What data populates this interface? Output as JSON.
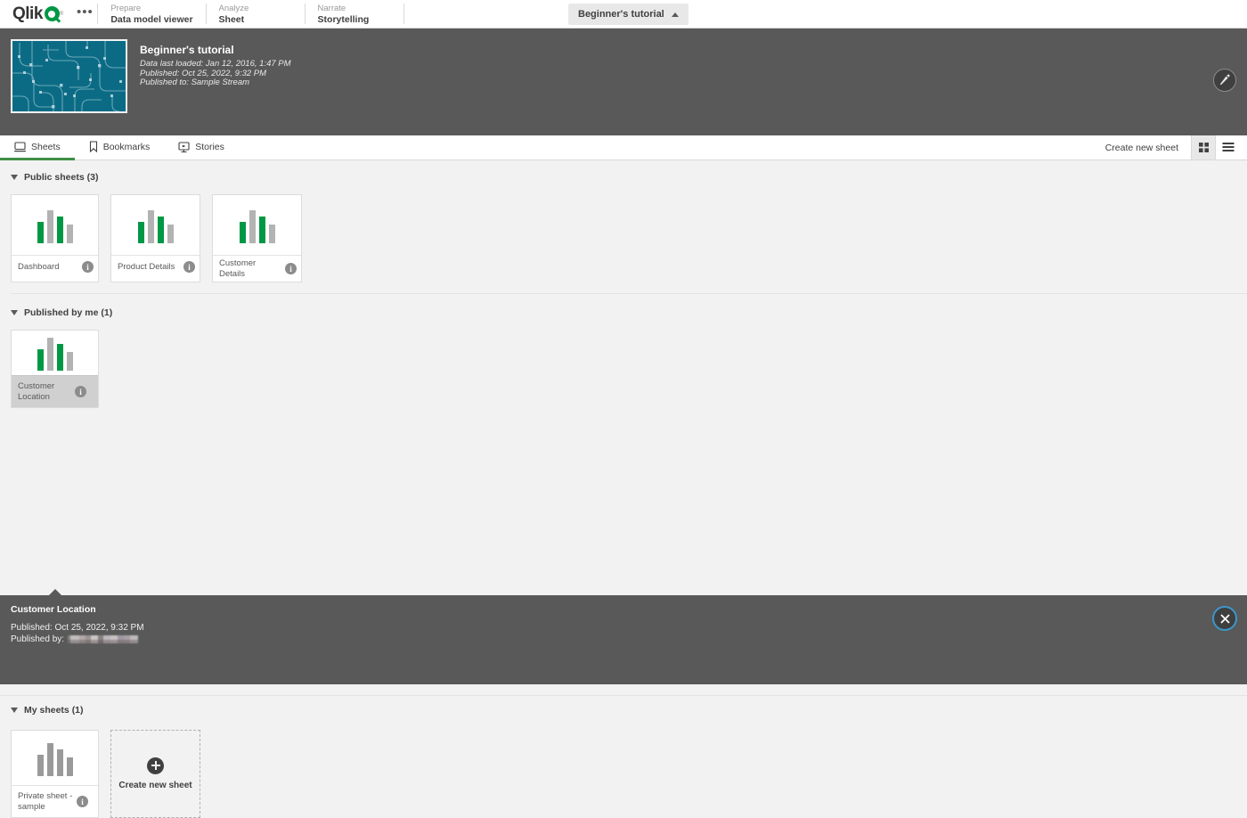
{
  "brand": {
    "logo_text": "Qlik",
    "logo_tm": "®",
    "accent_green": "#009845",
    "tab_active_green": "#3f8f45",
    "header_gray": "#595959",
    "page_bg": "#f2f2f2",
    "thumb_teal": "#0b6b85",
    "focus_blue": "#3b97c9"
  },
  "topnav": {
    "overflow_menu": "•••",
    "items": [
      {
        "kicker": "Prepare",
        "label": "Data model viewer"
      },
      {
        "kicker": "Analyze",
        "label": "Sheet"
      },
      {
        "kicker": "Narrate",
        "label": "Storytelling"
      }
    ],
    "app_picker_label": "Beginner's tutorial",
    "app_picker_icon": "chevron-up-icon"
  },
  "app_header": {
    "title": "Beginner's tutorial",
    "meta": [
      "Data last loaded: Jan 12, 2016, 1:47 PM",
      "Published: Oct 25, 2022, 9:32 PM",
      "Published to: Sample Stream"
    ],
    "edit_icon": "pencil-icon",
    "thumbnail_icon": "app-circuit-thumbnail"
  },
  "tabbar": {
    "tabs": [
      {
        "label": "Sheets",
        "icon": "sheet-icon",
        "active": true
      },
      {
        "label": "Bookmarks",
        "icon": "bookmark-icon",
        "active": false
      },
      {
        "label": "Stories",
        "icon": "story-icon",
        "active": false
      }
    ],
    "create_new_sheet": "Create new sheet",
    "view_grid_icon": "grid-view-icon",
    "view_list_icon": "list-view-icon",
    "view_mode": "grid"
  },
  "sections": [
    {
      "title": "Public sheets (3)",
      "expanded": true,
      "cards": [
        {
          "title": "Dashboard",
          "info_icon": "info-icon",
          "bars": "green",
          "selected": false
        },
        {
          "title": "Product Details",
          "info_icon": "info-icon",
          "bars": "green",
          "selected": false
        },
        {
          "title": "Customer Details",
          "info_icon": "info-icon",
          "bars": "green",
          "selected": false
        }
      ]
    },
    {
      "title": "Published by me (1)",
      "expanded": true,
      "cards": [
        {
          "title": "Customer Location",
          "info_icon": "info-icon",
          "bars": "green",
          "selected": true
        }
      ]
    },
    {
      "title": "My sheets (1)",
      "expanded": true,
      "cards": [
        {
          "title": "Private sheet - sample",
          "info_icon": "info-icon",
          "bars": "gray",
          "selected": false
        }
      ],
      "create_card": {
        "label": "Create new\nsheet",
        "icon": "plus-icon"
      }
    }
  ],
  "detail_panel": {
    "title": "Customer Location",
    "published_label": "Published: Oct 25, 2022, 9:32 PM",
    "published_by_label": "Published by:",
    "published_by_value_redacted": true,
    "close_icon": "close-icon"
  }
}
